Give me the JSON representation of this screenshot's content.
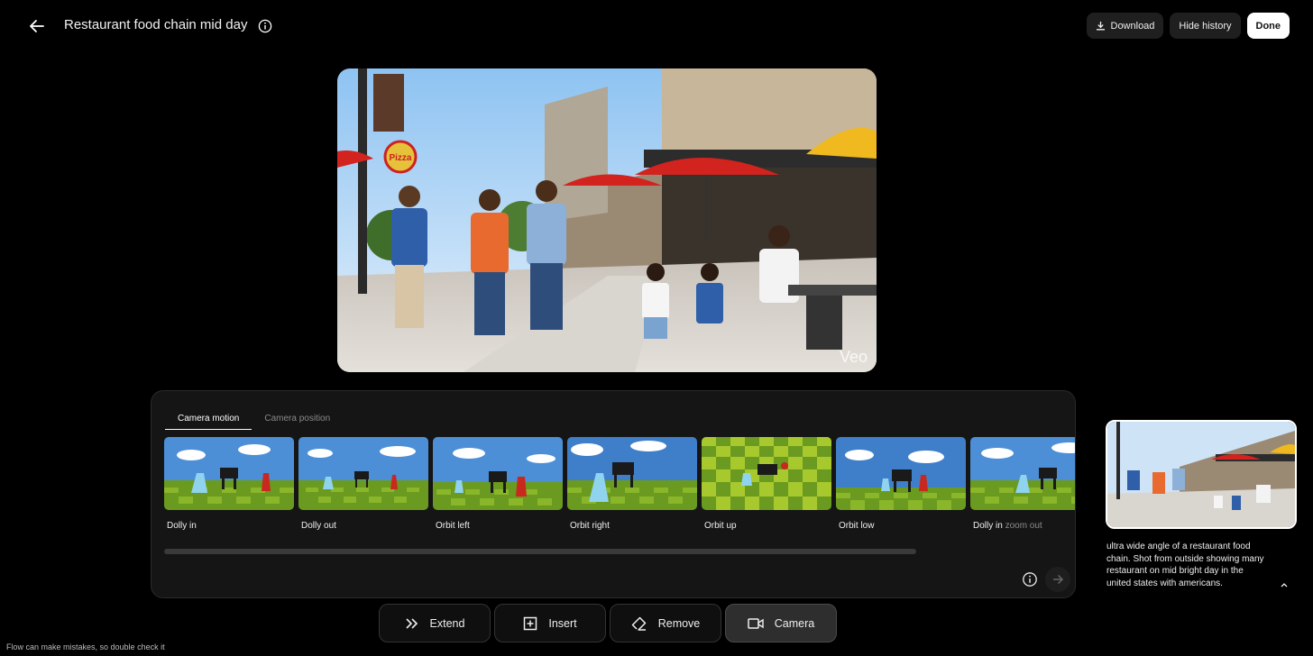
{
  "header": {
    "title": "Restaurant food chain mid day",
    "download_label": "Download",
    "hide_history_label": "Hide history",
    "done_label": "Done"
  },
  "video": {
    "watermark": "Veo",
    "sign_text": "Pizza"
  },
  "camera_panel": {
    "tabs": [
      {
        "label": "Camera motion",
        "active": true
      },
      {
        "label": "Camera position",
        "active": false
      }
    ],
    "options": [
      {
        "label": "Dolly in"
      },
      {
        "label": "Dolly out"
      },
      {
        "label": "Orbit left"
      },
      {
        "label": "Orbit right"
      },
      {
        "label": "Orbit up"
      },
      {
        "label": "Orbit low"
      },
      {
        "label": "Dolly in",
        "suffix": "zoom out"
      }
    ]
  },
  "toolbar": {
    "items": [
      {
        "label": "Extend",
        "icon": "double-chevron-right-icon",
        "active": false
      },
      {
        "label": "Insert",
        "icon": "plus-square-icon",
        "active": false
      },
      {
        "label": "Remove",
        "icon": "eraser-icon",
        "active": false
      },
      {
        "label": "Camera",
        "icon": "video-camera-icon",
        "active": true
      }
    ]
  },
  "history": {
    "prompt": "ultra wide angle of a restaurant food chain. Shot from outside showing many restaurant on mid bright day in the united states with americans."
  },
  "footer": {
    "disclaimer": "Flow can make mistakes, so double check it"
  },
  "colors": {
    "background": "#000000",
    "panel": "#151515",
    "accent_sky": "#7fb6e8",
    "umbrella_red": "#d2231e"
  }
}
